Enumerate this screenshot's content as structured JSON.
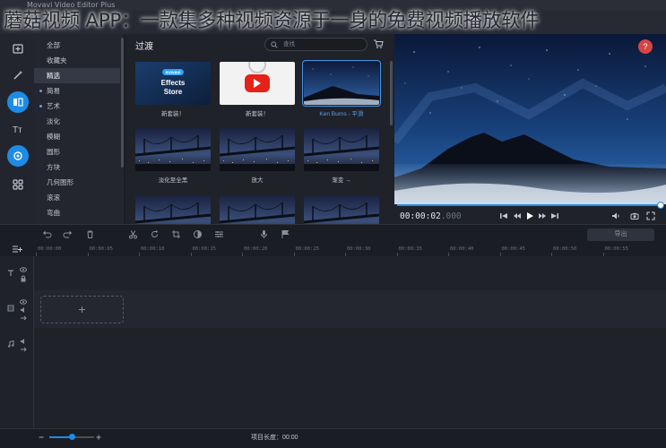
{
  "overlay_headline": "蘑菇视频 APP：一款集多种视频资源于一身的免费视频播放软件",
  "window": {
    "title": "Movavi Video Editor Plus"
  },
  "categories": [
    {
      "label": "全部",
      "dot": false
    },
    {
      "label": "收藏夹",
      "dot": false
    },
    {
      "label": "精选",
      "dot": false,
      "selected": true
    },
    {
      "label": "简易",
      "dot": true
    },
    {
      "label": "艺术",
      "dot": true
    },
    {
      "label": "淡化",
      "dot": false
    },
    {
      "label": "模糊",
      "dot": false
    },
    {
      "label": "圆形",
      "dot": false
    },
    {
      "label": "方块",
      "dot": false
    },
    {
      "label": "几何图形",
      "dot": false
    },
    {
      "label": "滚滚",
      "dot": false
    },
    {
      "label": "弯曲",
      "dot": false
    }
  ],
  "panel": {
    "title": "过渡",
    "search_placeholder": "查找",
    "tiles": [
      {
        "label": "新套装！",
        "thumb": "movavi-effects-store",
        "store_badge": "movavi",
        "store_text": "Effects Store"
      },
      {
        "label": "新套装！",
        "thumb": "youtube"
      },
      {
        "label": "Ken Burns - 平滑",
        "thumb": "night-mountain",
        "selected": true
      },
      {
        "label": "淡化至全黑",
        "thumb": "bridge-city"
      },
      {
        "label": "放大",
        "thumb": "bridge-city"
      },
      {
        "label": "渐变 →",
        "thumb": "bridge-city"
      },
      {
        "label": "",
        "thumb": "bridge-city"
      },
      {
        "label": "",
        "thumb": "bridge-city"
      },
      {
        "label": "",
        "thumb": "bridge-city"
      }
    ]
  },
  "player": {
    "timecode": "00:00:02",
    "timecode_ms": ".000",
    "help_label": "?",
    "progress": 1.0
  },
  "editor": {
    "export_label": "导出",
    "ruler": [
      "00:00:00",
      "00:00:05",
      "00:00:10",
      "00:00:15",
      "00:00:20",
      "00:00:25",
      "00:00:30",
      "00:00:35",
      "00:00:40",
      "00:00:45",
      "00:00:50",
      "00:00:55"
    ],
    "add_media_symbol": "+",
    "project_length": "项目长度：00:00",
    "zoom_level": 0.5
  },
  "colors": {
    "accent": "#1c8ce6",
    "help": "#d64545",
    "panel_bg": "#1f2229"
  }
}
